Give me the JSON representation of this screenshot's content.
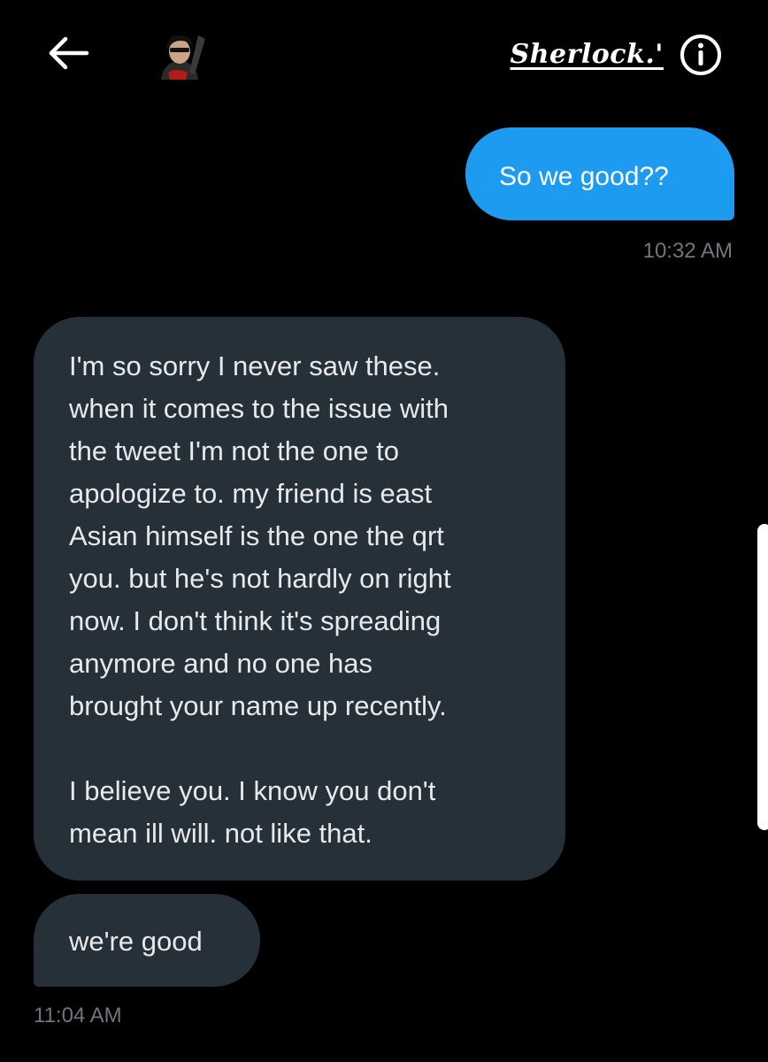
{
  "header": {
    "back_icon": "arrow-left-icon",
    "avatar_icon": "comic-hero-avatar",
    "contact_name": "Sherlock.'",
    "info_icon": "info-circle-icon"
  },
  "colors": {
    "background": "#000000",
    "sent_bubble": "#1d9bf0",
    "received_bubble": "#253038",
    "timestamp": "#71767b"
  },
  "messages": [
    {
      "direction": "sent",
      "text": "So we good??",
      "timestamp": "10:32 AM"
    },
    {
      "direction": "received",
      "paragraphs": [
        "I'm so sorry I never saw these.\nwhen it comes to the issue with\nthe tweet I'm not the one to\napologize to. my friend is east\nAsian himself is the one the qrt\nyou. but he's not hardly on right\nnow. I don't think it's spreading\nanymore and no one has\nbrought your name up recently.",
        "I believe you. I know you don't\nmean ill will. not like that."
      ]
    },
    {
      "direction": "received",
      "text": "we're good",
      "timestamp": "11:04 AM"
    }
  ]
}
